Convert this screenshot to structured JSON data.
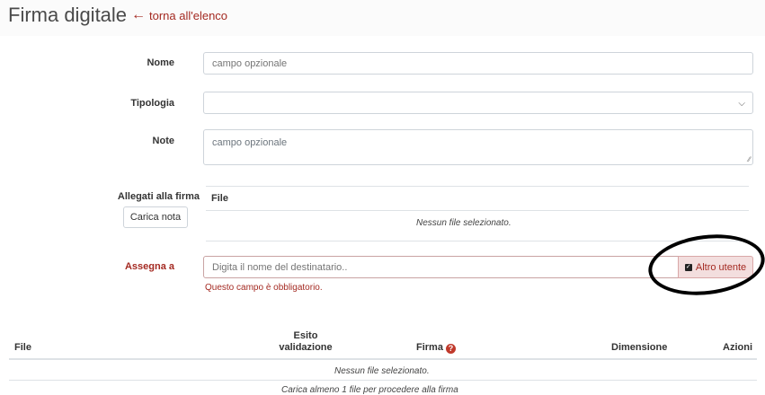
{
  "page": {
    "title": "Firma digitale",
    "back_link": "torna all'elenco"
  },
  "form": {
    "nome": {
      "label": "Nome",
      "placeholder": "campo opzionale"
    },
    "tipologia": {
      "label": "Tipologia",
      "value": ""
    },
    "note": {
      "label": "Note",
      "placeholder": "campo opzionale"
    },
    "allegati": {
      "label": "Allegati alla firma",
      "button": "Carica nota",
      "column_file": "File",
      "empty": "Nessun file selezionato."
    },
    "assegna": {
      "label": "Assegna a",
      "placeholder": "Digita il nome del destinatario..",
      "toggle_label": "Altro utente",
      "toggle_checked": true,
      "error": "Questo campo è obbligatorio."
    }
  },
  "files_table": {
    "columns": [
      "File",
      "Esito validazione",
      "Firma",
      "Dimensione",
      "Azioni"
    ],
    "esito_line1": "Esito",
    "esito_line2": "validazione",
    "empty": "Nessun file selezionato.",
    "hint": "Carica almeno 1 file per procedere alla firma"
  },
  "colors": {
    "accent": "#a42a22",
    "required_border": "#c9a3a3",
    "toggle_bg": "#f3dede"
  },
  "icons": [
    "arrow-left-icon",
    "chevron-down-icon",
    "checkbox-icon",
    "help-icon",
    "resize-handle-icon"
  ]
}
